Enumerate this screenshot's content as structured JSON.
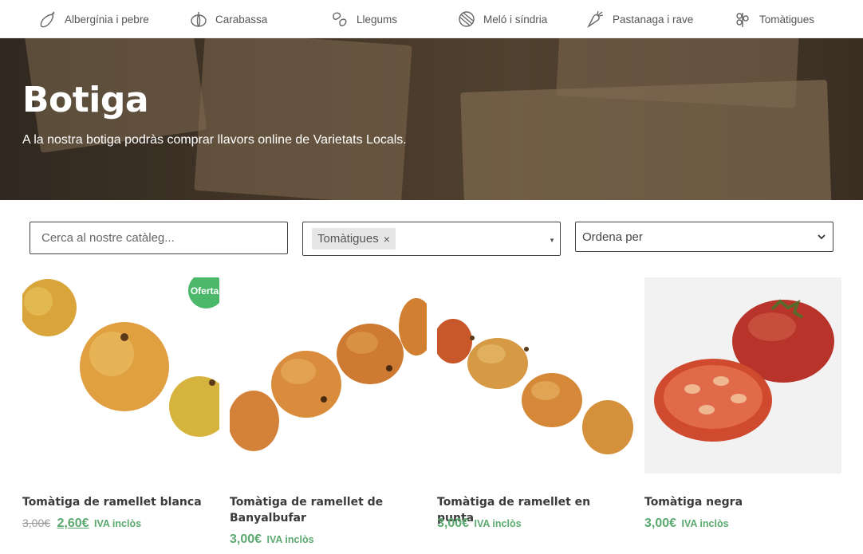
{
  "nav": {
    "items": [
      {
        "label": "Albergínia i pebre",
        "icon": "eggplant-icon"
      },
      {
        "label": "Carabassa",
        "icon": "pumpkin-icon"
      },
      {
        "label": "Llegums",
        "icon": "beans-icon"
      },
      {
        "label": "Meló i síndria",
        "icon": "melon-icon"
      },
      {
        "label": "Pastanaga i rave",
        "icon": "carrot-icon"
      },
      {
        "label": "Tomàtigues",
        "icon": "tomato-plant-icon"
      }
    ]
  },
  "hero": {
    "title": "Botiga",
    "subtitle": "A la nostra botiga podràs comprar llavors online de Varietats Locals."
  },
  "filters": {
    "search_placeholder": "Cerca al nostre catàleg...",
    "selected_tag": "Tomàtigues",
    "tag_remove": "×",
    "sort_label": "Ordena per"
  },
  "products": [
    {
      "name": "Tomàtiga de ramellet blanca",
      "old_price": "3,00€",
      "price": "2,60€",
      "tax": "IVA inclòs",
      "badge": "Oferta!"
    },
    {
      "name": "Tomàtiga de ramellet de Banyalbufar",
      "price": "3,00€",
      "tax": "IVA inclòs"
    },
    {
      "name": "Tomàtiga de ramellet en punta",
      "price": "3,00€",
      "tax": "IVA inclòs"
    },
    {
      "name": "Tomàtiga negra",
      "price": "3,00€",
      "tax": "IVA inclòs"
    }
  ],
  "colors": {
    "accent": "#5aa96e",
    "badge": "#4cb86a"
  }
}
